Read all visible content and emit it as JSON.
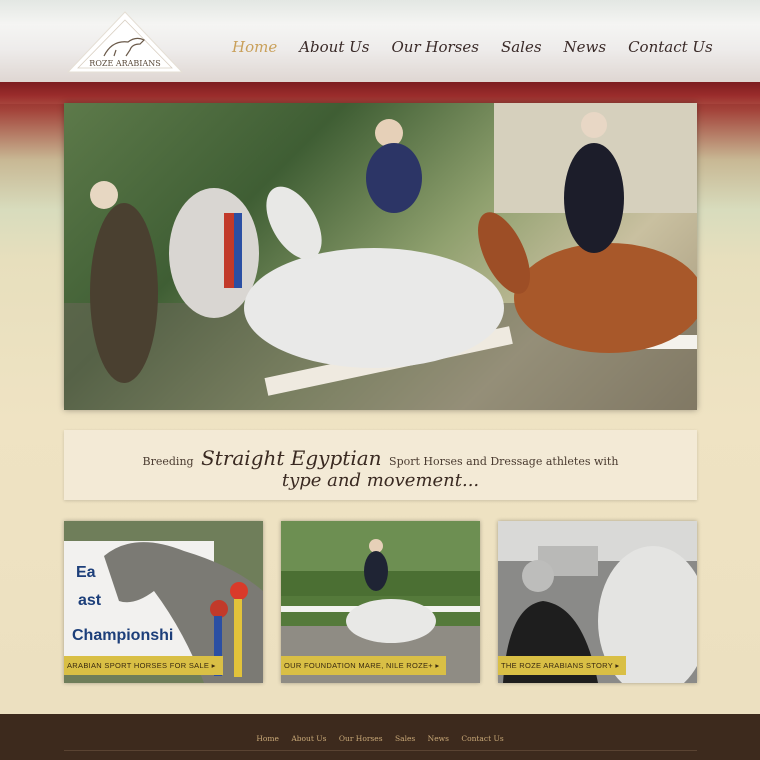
{
  "logo": {
    "text": "ROZE ARABIANS"
  },
  "nav": {
    "items": [
      {
        "label": "Home",
        "active": true
      },
      {
        "label": "About Us"
      },
      {
        "label": "Our Horses"
      },
      {
        "label": "Sales"
      },
      {
        "label": "News"
      },
      {
        "label": "Contact Us"
      }
    ]
  },
  "tagline": {
    "part1": "Breeding",
    "script1": "Straight Egyptian",
    "part2": "Sport Horses and Dressage athletes with",
    "script2": "type and movement..."
  },
  "cards": [
    {
      "button": "ARABIAN SPORT HORSES FOR SALE ▸",
      "sign_text": [
        "Ea",
        "ast",
        "Championshi"
      ]
    },
    {
      "button": "OUR FOUNDATION MARE, NILE ROZE+ ▸"
    },
    {
      "button": "THE ROZE ARABIANS STORY ▸"
    }
  ],
  "footer": {
    "links": [
      "Home",
      "About Us",
      "Our Horses",
      "Sales",
      "News",
      "Contact Us"
    ]
  },
  "colors": {
    "accent_gold": "#d9bf45",
    "header_red": "#8a1f22",
    "footer_brown": "#3d2a1d"
  }
}
